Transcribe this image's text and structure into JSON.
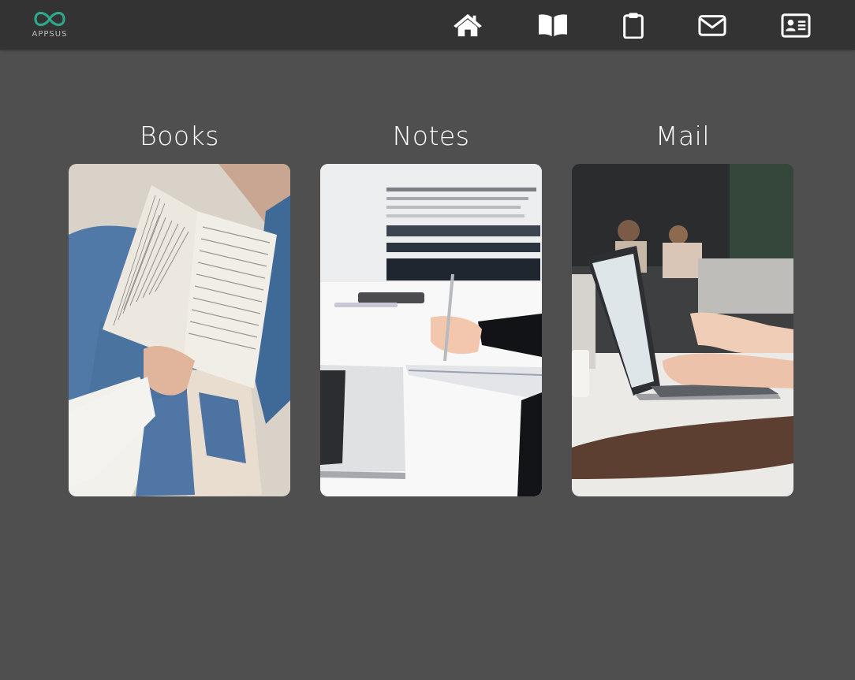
{
  "header": {
    "logo_text": "APPSUS",
    "brand_color": "#2fa58a",
    "nav": [
      {
        "name": "home",
        "icon": "home-icon"
      },
      {
        "name": "books",
        "icon": "book-open-icon"
      },
      {
        "name": "notes",
        "icon": "clipboard-icon"
      },
      {
        "name": "mail",
        "icon": "envelope-icon"
      },
      {
        "name": "about",
        "icon": "id-card-icon"
      }
    ]
  },
  "apps": [
    {
      "title": "Books",
      "image": "person-reading-open-book-photo"
    },
    {
      "title": "Notes",
      "image": "hand-writing-in-notebook-photo"
    },
    {
      "title": "Mail",
      "image": "hands-typing-on-laptop-photo"
    }
  ],
  "colors": {
    "background": "#4f4f4f",
    "header": "#333333",
    "text": "#ffffff"
  }
}
